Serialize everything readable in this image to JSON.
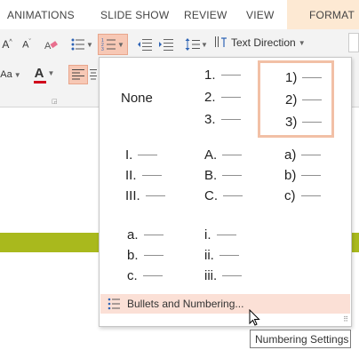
{
  "tabs": {
    "animations": "ANIMATIONS",
    "slide_show": "SLIDE SHOW",
    "review": "REVIEW",
    "view": "VIEW",
    "format": "FORMAT"
  },
  "ribbon": {
    "text_direction": "Text Direction",
    "font_size_prefix": "Aa",
    "font_color_letter": "A"
  },
  "gallery": {
    "none_label": "None",
    "cells": [
      [
        "1.",
        "2.",
        "3."
      ],
      [
        "1)",
        "2)",
        "3)"
      ],
      [
        "I.",
        "II.",
        "III."
      ],
      [
        "A.",
        "B.",
        "C."
      ],
      [
        "a)",
        "b)",
        "c)"
      ],
      [
        "a.",
        "b.",
        "c."
      ],
      [
        "i.",
        "ii.",
        "iii."
      ]
    ],
    "footer_label": "Bullets and Numbering..."
  },
  "tooltip": "Numbering Settings",
  "colors": {
    "accent": "#f7c8b5",
    "selected_border": "#f2c0a6",
    "footer_bg": "#fbe0d6",
    "green_band": "#a9b91d",
    "font_color_bar": "#d0021b"
  }
}
